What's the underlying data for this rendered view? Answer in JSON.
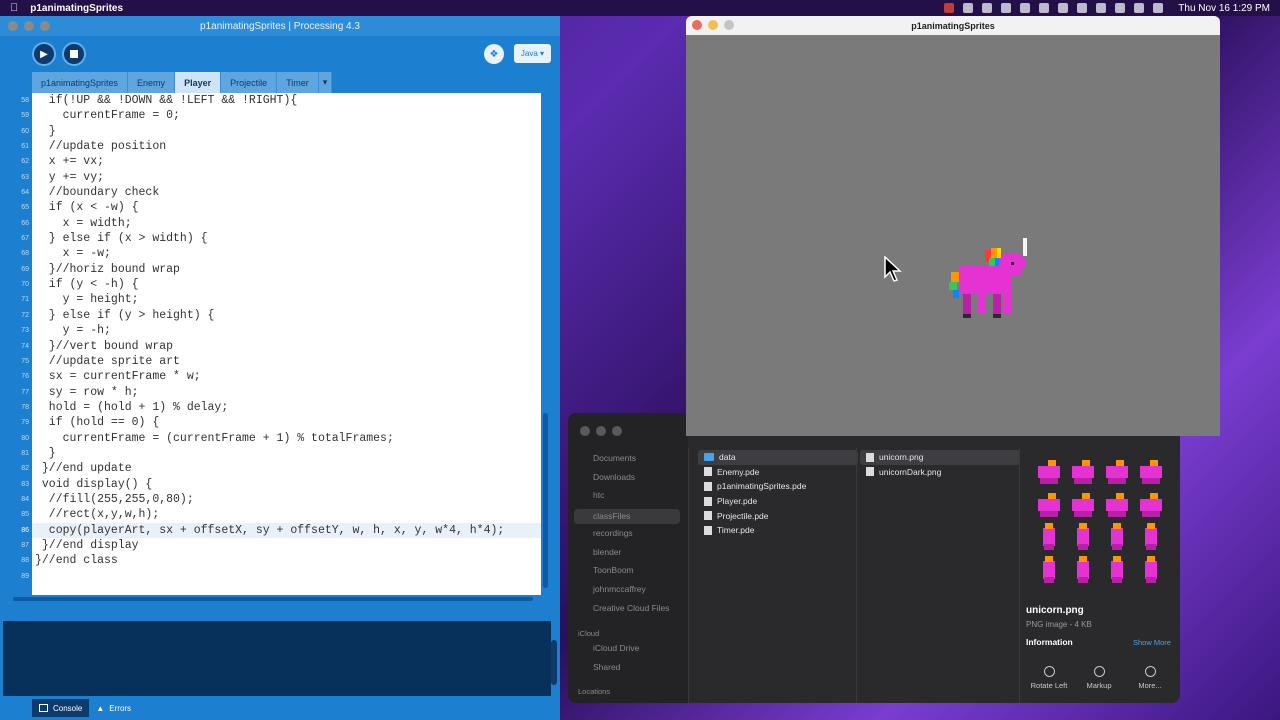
{
  "menubar": {
    "app_name": "p1animatingSprites",
    "datetime": "Thu Nov 16  1:29 PM"
  },
  "ide": {
    "window_title": "p1animatingSprites | Processing 4.3",
    "mode_label": "Java ▾",
    "tabs": [
      {
        "label": "p1animatingSprites"
      },
      {
        "label": "Enemy"
      },
      {
        "label": "Player"
      },
      {
        "label": "Projectile"
      },
      {
        "label": "Timer"
      }
    ],
    "active_tab": "Player",
    "highlighted_line": "86",
    "code_lines": [
      {
        "num": "58",
        "text": "  if(!UP && !DOWN && !LEFT && !RIGHT){"
      },
      {
        "num": "59",
        "text": "    currentFrame = 0;"
      },
      {
        "num": "60",
        "text": "  }"
      },
      {
        "num": "61",
        "text": "  //update position"
      },
      {
        "num": "62",
        "text": "  x += vx;"
      },
      {
        "num": "63",
        "text": "  y += vy;"
      },
      {
        "num": "64",
        "text": "  //boundary check"
      },
      {
        "num": "65",
        "text": "  if (x < -w) {"
      },
      {
        "num": "66",
        "text": "    x = width;"
      },
      {
        "num": "67",
        "text": "  } else if (x > width) {"
      },
      {
        "num": "68",
        "text": "    x = -w;"
      },
      {
        "num": "69",
        "text": "  }//horiz bound wrap"
      },
      {
        "num": "70",
        "text": "  if (y < -h) {"
      },
      {
        "num": "71",
        "text": "    y = height;"
      },
      {
        "num": "72",
        "text": "  } else if (y > height) {"
      },
      {
        "num": "73",
        "text": "    y = -h;"
      },
      {
        "num": "74",
        "text": "  }//vert bound wrap"
      },
      {
        "num": "75",
        "text": "  //update sprite art"
      },
      {
        "num": "76",
        "text": "  sx = currentFrame * w;"
      },
      {
        "num": "77",
        "text": "  sy = row * h;"
      },
      {
        "num": "78",
        "text": "  hold = (hold + 1) % delay;"
      },
      {
        "num": "79",
        "text": "  if (hold == 0) {"
      },
      {
        "num": "80",
        "text": "    currentFrame = (currentFrame + 1) % totalFrames;"
      },
      {
        "num": "81",
        "text": "  }"
      },
      {
        "num": "82",
        "text": " }//end update"
      },
      {
        "num": "83",
        "text": " void display() {"
      },
      {
        "num": "84",
        "text": "  //fill(255,255,0,80);"
      },
      {
        "num": "85",
        "text": "  //rect(x,y,w,h);"
      },
      {
        "num": "86",
        "text": "  copy(playerArt, sx + offsetX, sy + offsetY, w, h, x, y, w*4, h*4);"
      },
      {
        "num": "87",
        "text": " }//end display"
      },
      {
        "num": "88",
        "text": "}//end class"
      },
      {
        "num": "89",
        "text": ""
      }
    ],
    "bottom_tabs": {
      "console": "Console",
      "errors": "Errors"
    }
  },
  "sketch": {
    "window_title": "p1animatingSprites",
    "background_color": "#7a7a7a"
  },
  "finder": {
    "sidebar": {
      "favorites": [
        "Documents",
        "Downloads",
        "htc",
        "classFiles",
        "recordings",
        "blender",
        "ToonBoom",
        "johnmccaffrey",
        "Creative Cloud Files"
      ],
      "selected": "classFiles",
      "icloud_header": "iCloud",
      "icloud": [
        "iCloud Drive",
        "Shared"
      ],
      "locations_header": "Locations"
    },
    "column1": [
      "data",
      "Enemy.pde",
      "p1animatingSprites.pde",
      "Player.pde",
      "Projectile.pde",
      "Timer.pde"
    ],
    "column2": [
      "unicorn.png",
      "unicornDark.png"
    ],
    "preview": {
      "filename": "unicorn.png",
      "kind": "PNG image - 4 KB",
      "info_label": "Information",
      "show_more": "Show More",
      "actions": [
        "Rotate Left",
        "Markup",
        "More..."
      ]
    }
  }
}
